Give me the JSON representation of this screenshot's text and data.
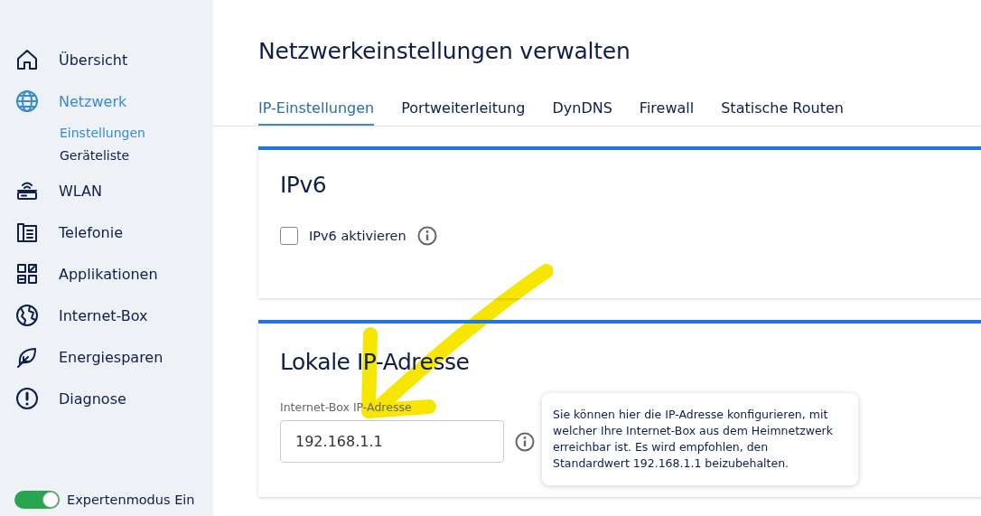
{
  "sidebar": {
    "items": [
      {
        "label": "Übersicht",
        "selected": false
      },
      {
        "label": "Netzwerk",
        "selected": true,
        "children": [
          {
            "label": "Einstellungen",
            "selected": true
          },
          {
            "label": "Geräteliste",
            "selected": false
          }
        ]
      },
      {
        "label": "WLAN",
        "selected": false
      },
      {
        "label": "Telefonie",
        "selected": false
      },
      {
        "label": "Applikationen",
        "selected": false
      },
      {
        "label": "Internet-Box",
        "selected": false
      },
      {
        "label": "Energiesparen",
        "selected": false
      },
      {
        "label": "Diagnose",
        "selected": false
      }
    ],
    "expert_mode": {
      "label": "Expertenmodus Ein",
      "on": true
    }
  },
  "page_title": "Netzwerkeinstellungen verwalten",
  "tabs": [
    {
      "label": "IP-Einstellungen",
      "selected": true
    },
    {
      "label": "Portweiterleitung",
      "selected": false
    },
    {
      "label": "DynDNS",
      "selected": false
    },
    {
      "label": "Firewall",
      "selected": false
    },
    {
      "label": "Statische Routen",
      "selected": false
    }
  ],
  "ipv6": {
    "title": "IPv6",
    "checkbox": {
      "label": "IPv6 aktivieren",
      "checked": false
    }
  },
  "local_ip": {
    "title": "Lokale IP-Adresse",
    "field": {
      "label": "Internet-Box IP-Adresse",
      "value": "192.168.1.1"
    },
    "tooltip": "Sie können hier die IP-Adresse konfigurieren, mit welcher Ihre Internet-Box aus dem Heimnetzwerk erreichbar ist. Es wird empfohlen, den Standardwert 192.168.1.1 beizubehalten."
  }
}
